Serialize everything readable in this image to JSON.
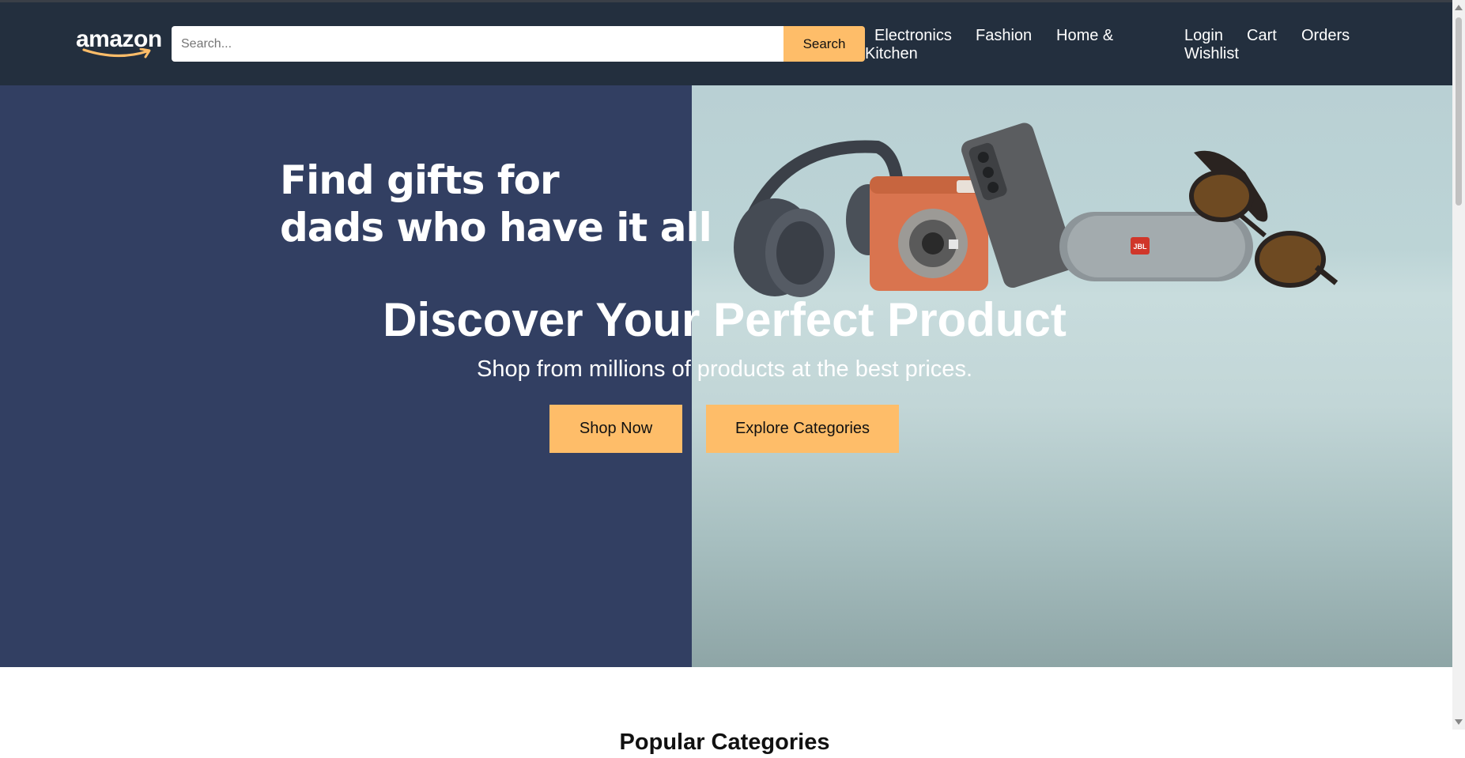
{
  "header": {
    "logo_text": "amazon",
    "search": {
      "placeholder": "Search...",
      "button_label": "Search"
    },
    "categories": [
      "Electronics",
      "Fashion",
      "Home &",
      "Kitchen"
    ],
    "account_links": [
      "Login",
      "Wishlist",
      "Cart",
      "Orders"
    ]
  },
  "hero": {
    "promo_line1": "Find gifts for",
    "promo_line2": "dads who have it all",
    "title": "Discover Your Perfect Product",
    "subtitle": "Shop from millions of products at the best prices.",
    "buttons": {
      "shop_now": "Shop Now",
      "explore": "Explore Categories"
    },
    "product_brand_label": "JBL"
  },
  "sections": {
    "categories_title": "Popular Categories"
  },
  "colors": {
    "header_bg": "#232f3e",
    "accent": "#febd69",
    "hero_left": "#323f62",
    "hero_right": "#b9d0d4"
  }
}
